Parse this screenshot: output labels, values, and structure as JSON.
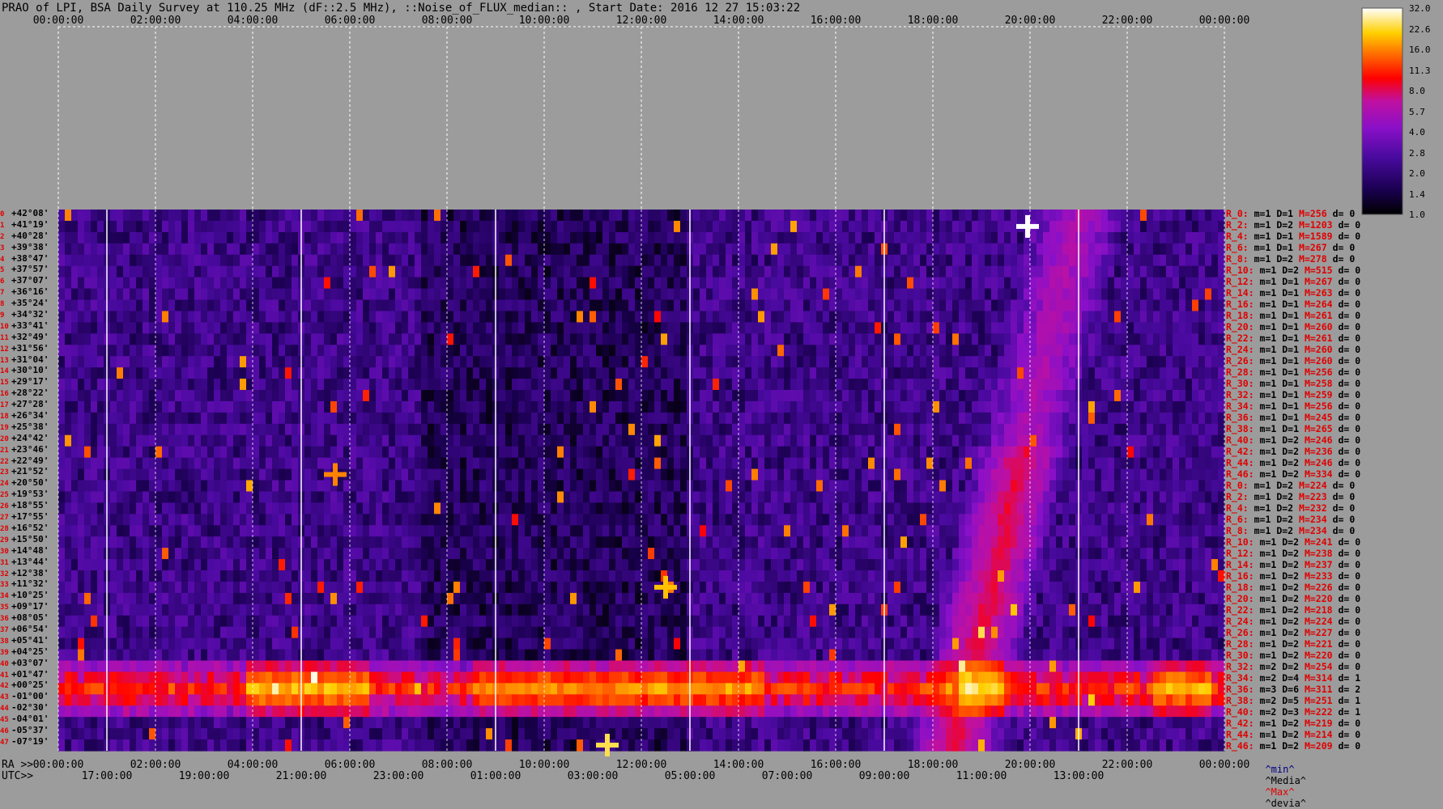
{
  "title": "PRAO of LPI, BSA Daily Survey at 110.25 MHz (dF::2.5 MHz), ::Noise_of_FLUX_median:: , Start Date: 2016 12 27 15:03:22",
  "chart_data": {
    "type": "heatmap",
    "title": "PRAO of LPI, BSA Daily Survey at 110.25 MHz (dF::2.5 MHz), ::Noise_of_FLUX_median:: , Start Date: 2016 12 27 15:03:22",
    "x_axis_top_ticks": [
      "00:00:00",
      "02:00:00",
      "04:00:00",
      "06:00:00",
      "08:00:00",
      "10:00:00",
      "12:00:00",
      "14:00:00",
      "16:00:00",
      "18:00:00",
      "20:00:00",
      "22:00:00",
      "00:00:00"
    ],
    "x_axis_ra_label": "RA >>",
    "x_axis_ra_ticks": [
      "00:00:00",
      "02:00:00",
      "04:00:00",
      "06:00:00",
      "08:00:00",
      "10:00:00",
      "12:00:00",
      "14:00:00",
      "16:00:00",
      "18:00:00",
      "20:00:00",
      "22:00:00",
      "00:00:00"
    ],
    "x_axis_utc_label": "UTC>>",
    "x_axis_utc_ticks": [
      "17:00:00",
      "19:00:00",
      "21:00:00",
      "23:00:00",
      "01:00:00",
      "03:00:00",
      "05:00:00",
      "07:00:00",
      "09:00:00",
      "11:00:00",
      "13:00:00"
    ],
    "ra_hours_range": [
      0,
      24
    ],
    "declinations": [
      "+42°08'",
      "+41°19'",
      "+40°28'",
      "+39°38'",
      "+38°47'",
      "+37°57'",
      "+37°07'",
      "+36°16'",
      "+35°24'",
      "+34°32'",
      "+33°41'",
      "+32°49'",
      "+31°56'",
      "+31°04'",
      "+30°10'",
      "+29°17'",
      "+28°22'",
      "+27°28'",
      "+26°34'",
      "+25°38'",
      "+24°42'",
      "+23°46'",
      "+22°49'",
      "+21°52'",
      "+20°50'",
      "+19°53'",
      "+18°55'",
      "+17°55'",
      "+16°52'",
      "+15°50'",
      "+14°48'",
      "+13°44'",
      "+12°38'",
      "+11°32'",
      "+10°25'",
      "+09°17'",
      "+08°05'",
      "+06°54'",
      "+05°41'",
      "+04°25'",
      "+03°07'",
      "+01°47'",
      "+00°25'",
      "-01°00'",
      "-02°30'",
      "-04°01'",
      "-05°37'",
      "-07°19'"
    ],
    "row_indices": [
      "0",
      "1",
      "2",
      "3",
      "4",
      "5",
      "6",
      "7",
      "8",
      "9",
      "10",
      "11",
      "12",
      "13",
      "14",
      "15",
      "16",
      "17",
      "18",
      "19",
      "20",
      "21",
      "22",
      "23",
      "24",
      "25",
      "26",
      "27",
      "28",
      "29",
      "30",
      "31",
      "32",
      "33",
      "34",
      "35",
      "36",
      "37",
      "38",
      "39",
      "40",
      "41",
      "42",
      "43",
      "44",
      "45",
      "46",
      "47"
    ],
    "colorbar_ticks": [
      "32.0",
      "22.6",
      "16.0",
      "11.3",
      "8.0",
      "5.7",
      "4.0",
      "2.8",
      "2.0",
      "1.4",
      "1.0"
    ],
    "colorbar_range": [
      1.0,
      32.0
    ],
    "colorbar_scale": "log",
    "bright_sources_ra_hours": [
      {
        "ra": 19.95,
        "dec_row": 1,
        "level": 32
      },
      {
        "ra": 5.7,
        "dec_row": 23,
        "level": 16
      },
      {
        "ra": 12.5,
        "dec_row": 33,
        "level": 20
      },
      {
        "ra": 11.3,
        "dec_row": 47,
        "level": 24
      }
    ],
    "equatorial_band_row_range": [
      40,
      44
    ]
  },
  "side_stats": [
    {
      "r": "R_0:",
      "m": "m=1",
      "D": "D=1",
      "M": "M=256",
      "d": "d= 0"
    },
    {
      "r": "R_2:",
      "m": "m=1",
      "D": "D=2",
      "M": "M=1203",
      "d": "d= 0"
    },
    {
      "r": "R_4:",
      "m": "m=1",
      "D": "D=1",
      "M": "M=1589",
      "d": "d= 0"
    },
    {
      "r": "R_6:",
      "m": "m=1",
      "D": "D=1",
      "M": "M=267",
      "d": "d= 0"
    },
    {
      "r": "R_8:",
      "m": "m=1",
      "D": "D=2",
      "M": "M=278",
      "d": "d= 0"
    },
    {
      "r": "R_10:",
      "m": "m=1",
      "D": "D=2",
      "M": "M=515",
      "d": "d= 0"
    },
    {
      "r": "R_12:",
      "m": "m=1",
      "D": "D=1",
      "M": "M=267",
      "d": "d= 0"
    },
    {
      "r": "R_14:",
      "m": "m=1",
      "D": "D=1",
      "M": "M=263",
      "d": "d= 0"
    },
    {
      "r": "R_16:",
      "m": "m=1",
      "D": "D=1",
      "M": "M=264",
      "d": "d= 0"
    },
    {
      "r": "R_18:",
      "m": "m=1",
      "D": "D=1",
      "M": "M=261",
      "d": "d= 0"
    },
    {
      "r": "R_20:",
      "m": "m=1",
      "D": "D=1",
      "M": "M=260",
      "d": "d= 0"
    },
    {
      "r": "R_22:",
      "m": "m=1",
      "D": "D=1",
      "M": "M=261",
      "d": "d= 0"
    },
    {
      "r": "R_24:",
      "m": "m=1",
      "D": "D=1",
      "M": "M=260",
      "d": "d= 0"
    },
    {
      "r": "R_26:",
      "m": "m=1",
      "D": "D=1",
      "M": "M=260",
      "d": "d= 0"
    },
    {
      "r": "R_28:",
      "m": "m=1",
      "D": "D=1",
      "M": "M=256",
      "d": "d= 0"
    },
    {
      "r": "R_30:",
      "m": "m=1",
      "D": "D=1",
      "M": "M=258",
      "d": "d= 0"
    },
    {
      "r": "R_32:",
      "m": "m=1",
      "D": "D=1",
      "M": "M=259",
      "d": "d= 0"
    },
    {
      "r": "R_34:",
      "m": "m=1",
      "D": "D=1",
      "M": "M=256",
      "d": "d= 0"
    },
    {
      "r": "R_36:",
      "m": "m=1",
      "D": "D=1",
      "M": "M=245",
      "d": "d= 0"
    },
    {
      "r": "R_38:",
      "m": "m=1",
      "D": "D=1",
      "M": "M=265",
      "d": "d= 0"
    },
    {
      "r": "R_40:",
      "m": "m=1",
      "D": "D=2",
      "M": "M=246",
      "d": "d= 0"
    },
    {
      "r": "R_42:",
      "m": "m=1",
      "D": "D=2",
      "M": "M=236",
      "d": "d= 0"
    },
    {
      "r": "R_44:",
      "m": "m=1",
      "D": "D=2",
      "M": "M=246",
      "d": "d= 0"
    },
    {
      "r": "R_46:",
      "m": "m=1",
      "D": "D=2",
      "M": "M=334",
      "d": "d= 0"
    },
    {
      "r": "R_0:",
      "m": "m=1",
      "D": "D=2",
      "M": "M=224",
      "d": "d= 0"
    },
    {
      "r": "R_2:",
      "m": "m=1",
      "D": "D=2",
      "M": "M=223",
      "d": "d= 0"
    },
    {
      "r": "R_4:",
      "m": "m=1",
      "D": "D=2",
      "M": "M=232",
      "d": "d= 0"
    },
    {
      "r": "R_6:",
      "m": "m=1",
      "D": "D=2",
      "M": "M=234",
      "d": "d= 0"
    },
    {
      "r": "R_8:",
      "m": "m=1",
      "D": "D=2",
      "M": "M=234",
      "d": "d= 0"
    },
    {
      "r": "R_10:",
      "m": "m=1",
      "D": "D=2",
      "M": "M=241",
      "d": "d= 0"
    },
    {
      "r": "R_12:",
      "m": "m=1",
      "D": "D=2",
      "M": "M=238",
      "d": "d= 0"
    },
    {
      "r": "R_14:",
      "m": "m=1",
      "D": "D=2",
      "M": "M=237",
      "d": "d= 0"
    },
    {
      "r": "R_16:",
      "m": "m=1",
      "D": "D=2",
      "M": "M=233",
      "d": "d= 0"
    },
    {
      "r": "R_18:",
      "m": "m=1",
      "D": "D=2",
      "M": "M=226",
      "d": "d= 0"
    },
    {
      "r": "R_20:",
      "m": "m=1",
      "D": "D=2",
      "M": "M=220",
      "d": "d= 0"
    },
    {
      "r": "R_22:",
      "m": "m=1",
      "D": "D=2",
      "M": "M=218",
      "d": "d= 0"
    },
    {
      "r": "R_24:",
      "m": "m=1",
      "D": "D=2",
      "M": "M=224",
      "d": "d= 0"
    },
    {
      "r": "R_26:",
      "m": "m=1",
      "D": "D=2",
      "M": "M=227",
      "d": "d= 0"
    },
    {
      "r": "R_28:",
      "m": "m=1",
      "D": "D=2",
      "M": "M=221",
      "d": "d= 0"
    },
    {
      "r": "R_30:",
      "m": "m=1",
      "D": "D=2",
      "M": "M=220",
      "d": "d= 0"
    },
    {
      "r": "R_32:",
      "m": "m=2",
      "D": "D=2",
      "M": "M=254",
      "d": "d= 0"
    },
    {
      "r": "R_34:",
      "m": "m=2",
      "D": "D=4",
      "M": "M=314",
      "d": "d= 1"
    },
    {
      "r": "R_36:",
      "m": "m=3",
      "D": "D=6",
      "M": "M=311",
      "d": "d= 2"
    },
    {
      "r": "R_38:",
      "m": "m=2",
      "D": "D=5",
      "M": "M=251",
      "d": "d= 1"
    },
    {
      "r": "R_40:",
      "m": "m=2",
      "D": "D=3",
      "M": "M=222",
      "d": "d= 1"
    },
    {
      "r": "R_42:",
      "m": "m=1",
      "D": "D=2",
      "M": "M=219",
      "d": "d= 0"
    },
    {
      "r": "R_44:",
      "m": "m=1",
      "D": "D=2",
      "M": "M=214",
      "d": "d= 0"
    },
    {
      "r": "R_46:",
      "m": "m=1",
      "D": "D=2",
      "M": "M=209",
      "d": "d= 0"
    }
  ],
  "legend_bottom": {
    "min": "^min^",
    "media": "^Media^",
    "max": "^Max^",
    "devia": "^devia^"
  },
  "colors": {
    "background": "#9c9c9c",
    "stat_red": "#e00000",
    "legend_min": "#000080",
    "legend_media": "#000000",
    "legend_max": "#e00000",
    "legend_devia": "#000000"
  }
}
